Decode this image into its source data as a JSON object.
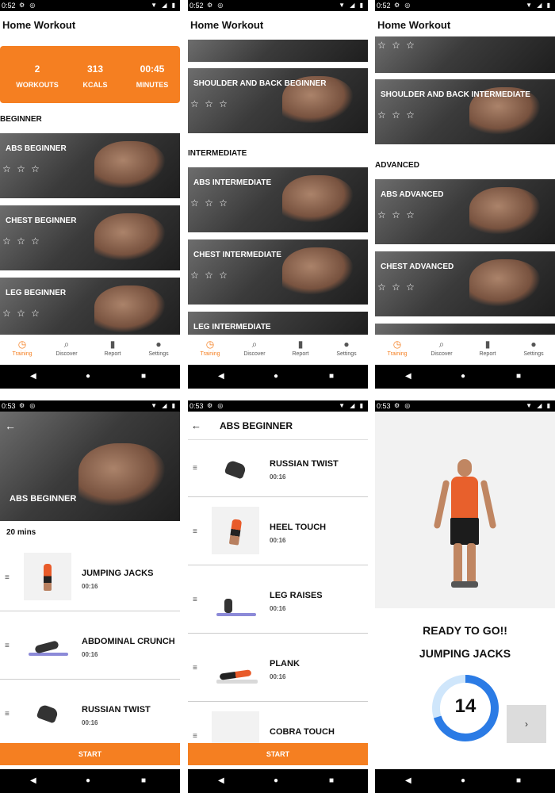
{
  "status": {
    "time_a": "0:52",
    "time_b": "0:53"
  },
  "app_title": "Home Workout",
  "stats": {
    "workouts_value": "2",
    "workouts_label": "WORKOUTS",
    "kcals_value": "313",
    "kcals_label": "KCALS",
    "minutes_value": "00:45",
    "minutes_label": "MINUTES"
  },
  "sections": {
    "beginner": "BEGINNER",
    "intermediate": "INTERMEDIATE",
    "advanced": "ADVANCED"
  },
  "cards": {
    "abs_beginner": "ABS BEGINNER",
    "chest_beginner": "CHEST BEGINNER",
    "leg_beginner": "LEG BEGINNER",
    "shoulder_back_beginner": "SHOULDER AND BACK BEGINNER",
    "abs_intermediate": "ABS INTERMEDIATE",
    "chest_intermediate": "CHEST INTERMEDIATE",
    "leg_intermediate": "LEG INTERMEDIATE",
    "shoulder_back_intermediate": "SHOULDER AND BACK INTERMEDIATE",
    "abs_advanced": "ABS ADVANCED",
    "chest_advanced": "CHEST ADVANCED",
    "stars": "☆ ☆ ☆"
  },
  "tabs": {
    "training": "Training",
    "discover": "Discover",
    "report": "Report",
    "settings": "Settings"
  },
  "workout_detail": {
    "title": "ABS BEGINNER",
    "duration": "20 mins"
  },
  "exercises": {
    "jumping_jacks": "JUMPING JACKS",
    "abdominal_crunch": "ABDOMINAL CRUNCH",
    "russian_twist": "RUSSIAN TWIST",
    "heel_touch": "HEEL TOUCH",
    "leg_raises": "LEG RAISES",
    "plank": "PLANK",
    "cobra_touch": "COBRA TOUCH",
    "time": "00:16"
  },
  "start_label": "START",
  "ready": {
    "heading": "READY TO GO!!",
    "exercise": "JUMPING JACKS",
    "countdown": "14",
    "countdown_fraction": 0.7
  },
  "colors": {
    "accent": "#f57f21",
    "ring": "#2b7be5",
    "ring_track": "#cfe6fb"
  }
}
